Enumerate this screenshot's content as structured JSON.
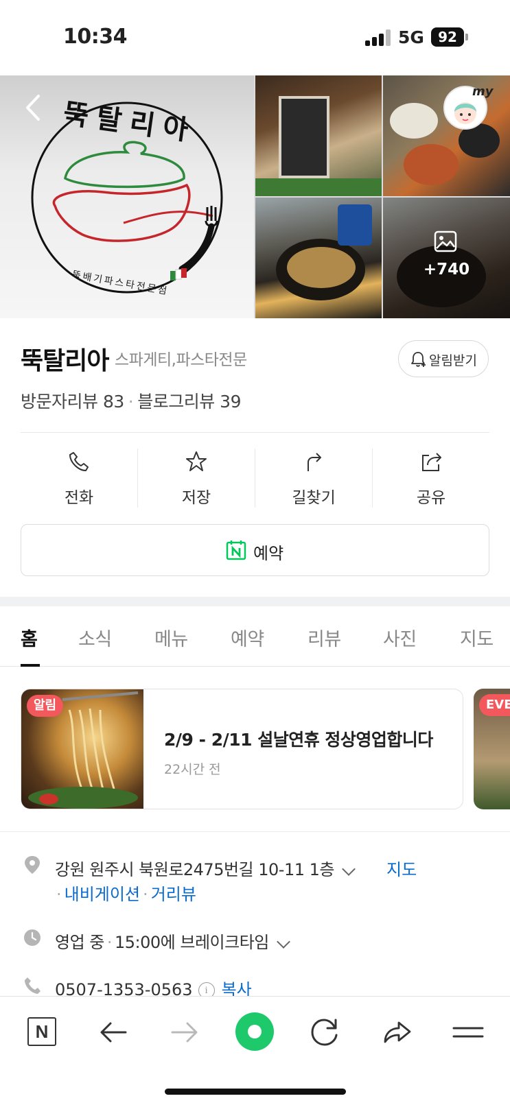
{
  "status_bar": {
    "time": "10:34",
    "network": "5G",
    "battery": "92"
  },
  "gallery": {
    "logo_title": "뚝탈리아",
    "logo_subtitle": "뚝배기파스타전문점",
    "my_badge": "my",
    "more_photos": "+740"
  },
  "place": {
    "name": "뚝탈리아",
    "category": "스파게티,파스타전문",
    "alarm_label": "알림받기",
    "visitor_reviews": "방문자리뷰 83",
    "blog_reviews": "블로그리뷰 39"
  },
  "actions": [
    {
      "label": "전화",
      "icon": "phone-icon"
    },
    {
      "label": "저장",
      "icon": "star-icon"
    },
    {
      "label": "길찾기",
      "icon": "directions-icon"
    },
    {
      "label": "공유",
      "icon": "share-icon"
    }
  ],
  "reserve": {
    "label": "예약",
    "icon": "naver-calendar-icon"
  },
  "tabs": [
    "홈",
    "소식",
    "메뉴",
    "예약",
    "리뷰",
    "사진",
    "지도"
  ],
  "active_tab": "홈",
  "notices": [
    {
      "badge": "알림",
      "title": "2/9 - 2/11 설날연휴 정상영업합니다",
      "time": "22시간 전"
    },
    {
      "badge": "EVENT"
    }
  ],
  "info": {
    "address": "강원 원주시 북원로2475번길 10-11 1층",
    "map_link": "지도",
    "navigation_link": "내비게이션",
    "street_view_link": "거리뷰",
    "status": "영업 중",
    "hours_note": "15:00에 브레이크타임",
    "phone": "0507-1353-0563",
    "copy_link": "복사"
  },
  "bottom_bar": {
    "n_label": "N"
  },
  "colors": {
    "accent_green": "#1ec96c",
    "link_blue": "#0b6bcc",
    "badge_red": "#f3585c"
  }
}
